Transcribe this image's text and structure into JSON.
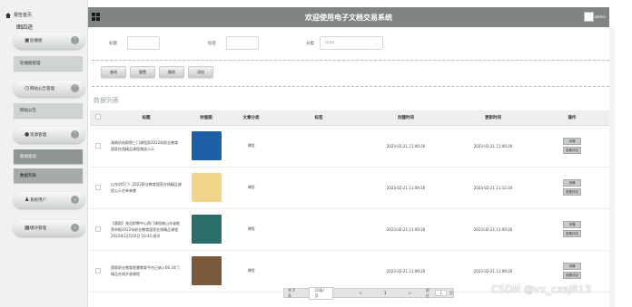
{
  "app": {
    "title": "欢迎使用电子文档交易系统",
    "user": "admin"
  },
  "sidebar": {
    "home": "报告首页",
    "user_label": "图四迹",
    "items": [
      {
        "label": "轮播图",
        "icon": "image-icon",
        "subs": [
          "轮播图管理"
        ]
      },
      {
        "label": "网站公告管理",
        "icon": "clock-icon",
        "subs": [
          "网站公告"
        ]
      },
      {
        "label": "资源管理",
        "icon": "pin-icon",
        "subs": [
          "新闻资讯",
          "数据列表"
        ]
      },
      {
        "label": "系统用户",
        "icon": "user-icon",
        "subs": []
      },
      {
        "label": "模块管理",
        "icon": "grid-icon",
        "subs": []
      }
    ]
  },
  "search": {
    "title_label": "标题",
    "tag_label": "标签",
    "category_label": "分类",
    "category_placeholder": "请选择"
  },
  "buttons": {
    "search": "查询",
    "reset": "重置",
    "delete": "删除",
    "add": "添加"
  },
  "list": {
    "heading": "数据列表",
    "columns": [
      "标题",
      "封面图",
      "文章分类",
      "标签",
      "创建时间",
      "更新时间",
      "操作"
    ],
    "rows": [
      {
        "title": "湖南机电职院三门课程获2022年职业教育国家在线精品课程遴选公示",
        "category": "课程",
        "tag": "",
        "created": "2023-02-21 11:09:26",
        "updated": "2023-02-21 11:09:26",
        "cover_color": "#1f5fa8"
      },
      {
        "title": "山东005门！2022职业教育国家在线精品课程公示名单来袭",
        "category": "课程",
        "tag": "",
        "created": "2023-02-21 11:09:26",
        "updated": "2023-02-21 11:12:20",
        "cover_color": "#f2d58a"
      },
      {
        "title": "【喜报】海北职教中心两门课程被山东省推荐申报2022年职业教育国家在线精品课程 2022年12月16日 10:42 阅讯",
        "category": "课程",
        "tag": "",
        "created": "2023-02-21 11:09:26",
        "updated": "2023-02-21 11:09:26",
        "cover_color": "#2a6d6a"
      },
      {
        "title": "国家职业教育智慧教育平台已纳入66 24门精品在线开放课程",
        "category": "课程",
        "tag": "",
        "created": "2023-02-21 11:09:26",
        "updated": "2023-02-21 11:09:26",
        "cover_color": "#7a5a3a"
      }
    ],
    "actions": {
      "view": "详情",
      "edit": "查看评论"
    }
  },
  "pager": {
    "total": "共 4 条",
    "size": "10条/页",
    "prev": "<",
    "page": "1",
    "next": ">",
    "goto": "前往",
    "goto_page": "1",
    "unit": "页"
  },
  "watermark": "CSDN @vx_cxsj813"
}
